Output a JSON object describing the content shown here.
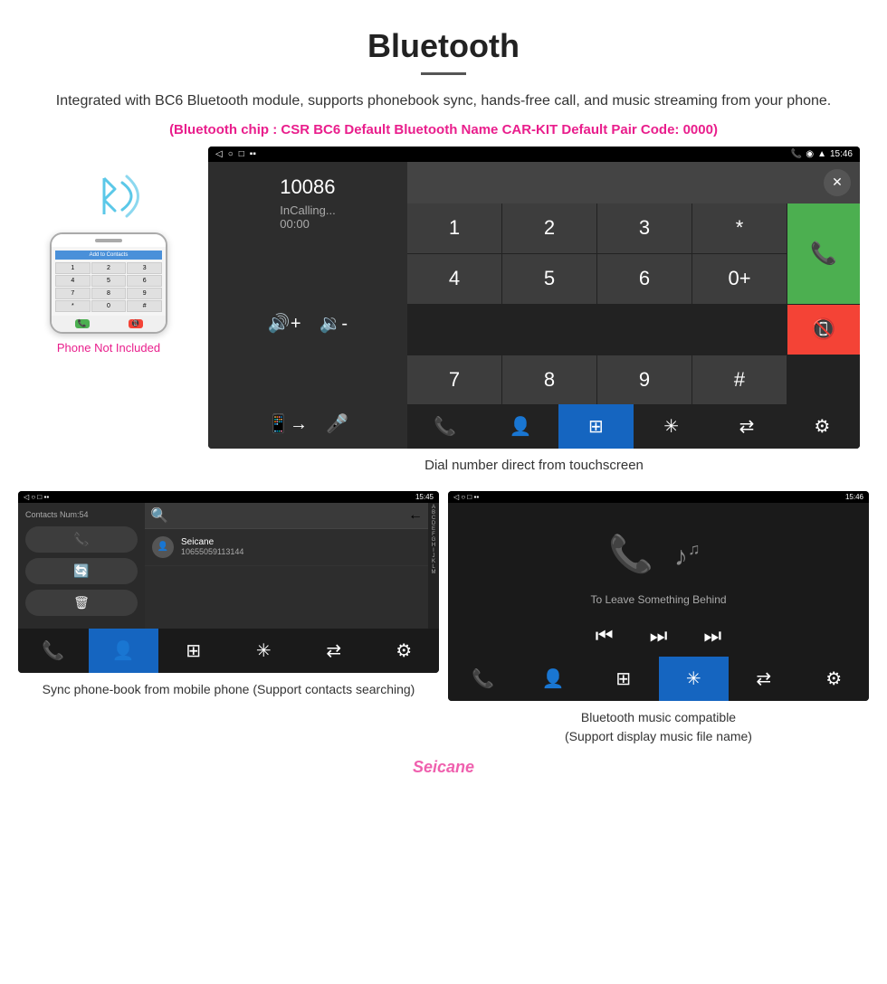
{
  "header": {
    "title": "Bluetooth",
    "description": "Integrated with BC6 Bluetooth module, supports phonebook sync, hands-free call, and music streaming from your phone.",
    "specs": "(Bluetooth chip : CSR BC6    Default Bluetooth Name CAR-KIT    Default Pair Code: 0000)",
    "caption_dial": "Dial number direct from touchscreen"
  },
  "dial_screen": {
    "status_time": "15:46",
    "number": "10086",
    "calling_label": "InCalling...",
    "timer": "00:00",
    "keypad": [
      "1",
      "2",
      "3",
      "*",
      "4",
      "5",
      "6",
      "0+",
      "7",
      "8",
      "9",
      "#"
    ]
  },
  "phone_mockup": {
    "add_contacts": "Add to Contacts",
    "keys": [
      "1",
      "2",
      "3",
      "4",
      "5",
      "6",
      "7",
      "8",
      "9",
      "*",
      "0",
      "#"
    ]
  },
  "not_included_label": "Phone Not Included",
  "bottom_left": {
    "screen_title": "Contacts",
    "status_time": "15:45",
    "contacts_num": "Contacts Num:54",
    "contact_name": "Seicane",
    "contact_number": "10655059113144",
    "search_placeholder": "",
    "caption": "Sync phone-book from mobile phone\n(Support contacts searching)",
    "alpha_letters": [
      "A",
      "B",
      "C",
      "D",
      "E",
      "F",
      "G",
      "H",
      "I",
      "J",
      "K",
      "L",
      "M"
    ]
  },
  "bottom_right": {
    "screen_title": "Music",
    "status_time": "15:46",
    "song_title": "To Leave Something Behind",
    "caption": "Bluetooth music compatible\n(Support display music file name)"
  },
  "nav_items": {
    "phone": "📞",
    "contacts": "👤",
    "keypad": "⌨",
    "bluetooth": "✱",
    "transfer": "⇄",
    "settings": "⚙"
  },
  "watermark": "Seicane"
}
